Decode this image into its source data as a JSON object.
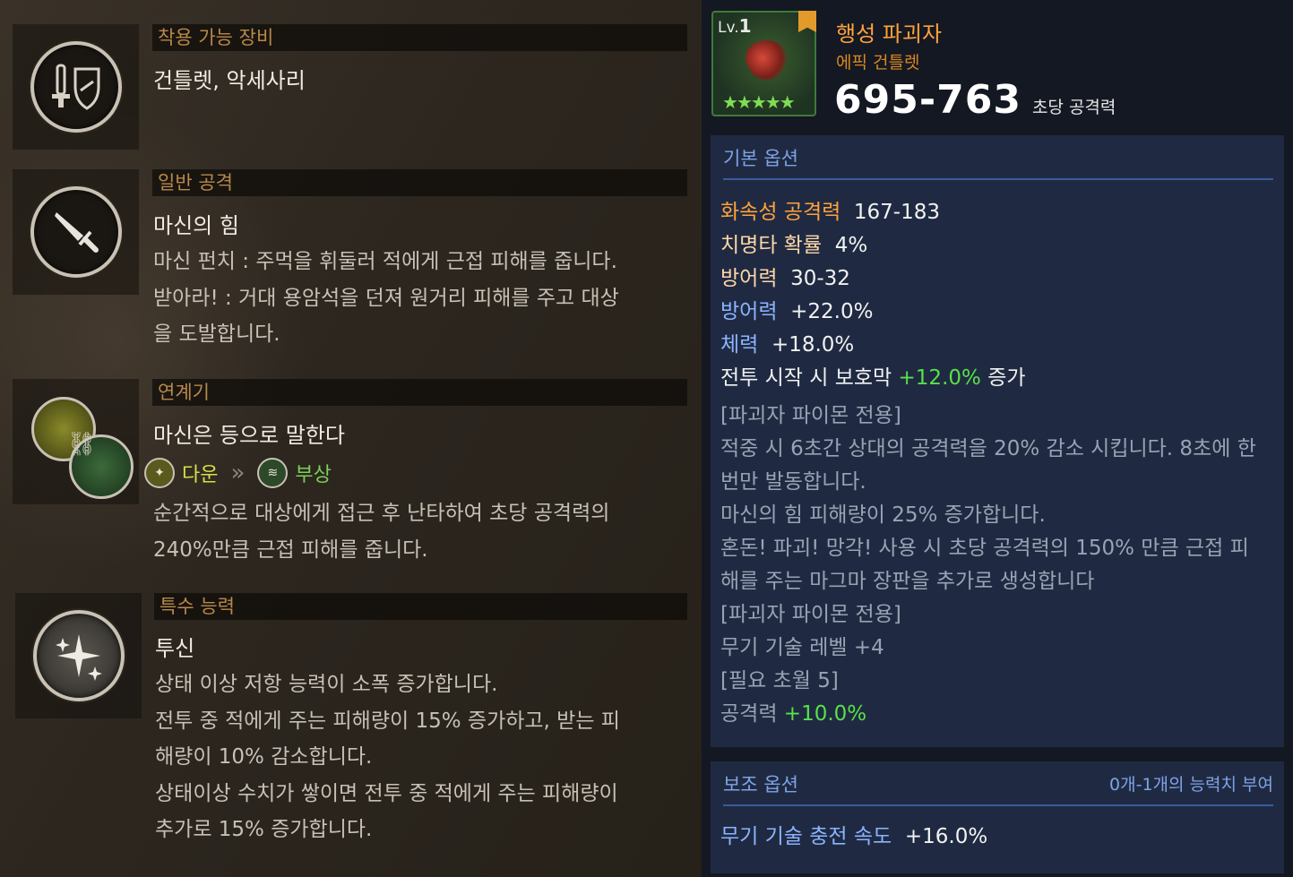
{
  "left": {
    "sections": [
      {
        "header": "착용 가능 장비",
        "title": "건틀렛, 악세사리"
      },
      {
        "header": "일반 공격",
        "title": "마신의 힘",
        "lines": [
          "마신 펀치 : 주먹을 휘둘러 적에게 근접 피해를 줍니다.",
          "받아라! : 거대 용암석을 던져 원거리 피해를 주고 대상",
          "을 도발합니다."
        ]
      },
      {
        "header": "연계기",
        "title": "마신은 등으로 말한다",
        "combo": {
          "first": "다운",
          "arrow": "»",
          "second": "부상"
        },
        "lines": [
          "순간적으로 대상에게 접근 후 난타하여 초당 공격력의",
          "240%만큼 근접 피해를 줍니다."
        ]
      },
      {
        "header": "특수 능력",
        "title": "투신",
        "lines": [
          "상태 이상 저항 능력이 소폭 증가합니다.",
          "전투 중 적에게 주는 피해량이 15% 증가하고, 받는 피",
          "해량이 10% 감소합니다.",
          "상태이상 수치가 쌓이면 전투 중 적에게 주는 피해량이",
          "추가로 15% 증가합니다."
        ]
      }
    ]
  },
  "item": {
    "lv_prefix": "Lv.",
    "lv": "1",
    "stars": "★★★★★",
    "name": "행성 파괴자",
    "type": "에픽 건틀렛",
    "attack": "695-763",
    "attack_label": "초당 공격력"
  },
  "basic": {
    "header": "기본 옵션",
    "stats": [
      {
        "k": "화속성 공격력",
        "v": "167-183"
      },
      {
        "k": "치명타 확률",
        "v": "4%"
      },
      {
        "k": "방어력",
        "v": "30-32"
      },
      {
        "k": "방어력",
        "v": "+22.0%"
      },
      {
        "k": "체력",
        "v": "+18.0%"
      }
    ],
    "shield": {
      "pre": "전투 시작 시 보호막",
      "val": "+12.0%",
      "post": "증가"
    },
    "notes": [
      "[파괴자 파이몬 전용]",
      "적중 시 6초간 상대의 공격력을 20% 감소 시킵니다. 8초에 한",
      "번만 발동합니다.",
      "마신의 힘 피해량이 25% 증가합니다.",
      "혼돈! 파괴! 망각! 사용 시 초당 공격력의 150% 만큼 근접 피",
      "해를 주는 마그마 장판을 추가로 생성합니다",
      "[파괴자 파이몬 전용]",
      "무기 기술 레벨 +4",
      "[필요 초월 5]"
    ],
    "last": {
      "k": "공격력",
      "v": "+10.0%"
    }
  },
  "aux": {
    "header": "보조 옵션",
    "right": "0개-1개의 능력치 부여",
    "stat": {
      "k": "무기 기술 충전 속도",
      "v": "+16.0%"
    }
  },
  "colors": {
    "orange": "#ffa23c",
    "green": "#58e04a",
    "blue": "#8cb4ff",
    "gold": "#b8894a"
  }
}
